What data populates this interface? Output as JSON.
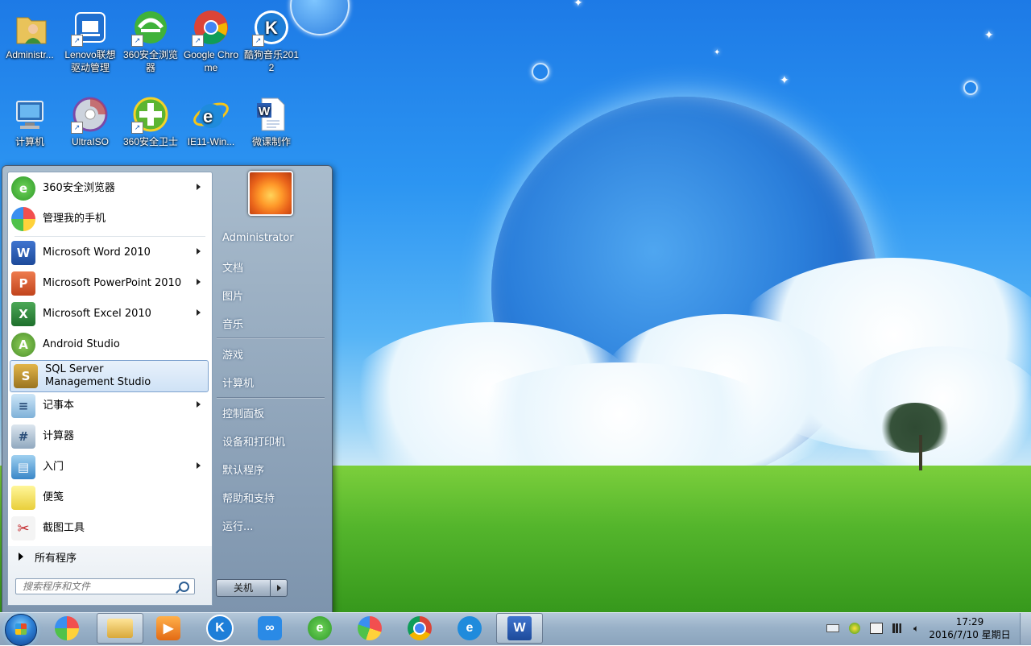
{
  "desktop": {
    "icons": [
      {
        "label": "Administr...",
        "icon": "user-folder-icon"
      },
      {
        "label": "Lenovo联想驱动管理",
        "icon": "lenovo-driver-icon"
      },
      {
        "label": "360安全浏览器",
        "icon": "browser-360-icon"
      },
      {
        "label": "Google Chrome",
        "icon": "chrome-icon"
      },
      {
        "label": "酷狗音乐2012",
        "icon": "kugou-icon"
      },
      {
        "label": "计算机",
        "icon": "computer-icon"
      },
      {
        "label": "UltraISO",
        "icon": "ultraiso-disc-icon"
      },
      {
        "label": "360安全卫士",
        "icon": "guard-360-icon"
      },
      {
        "label": "IE11-Win...",
        "icon": "ie-icon"
      },
      {
        "label": "微课制作",
        "icon": "word-document-icon"
      }
    ]
  },
  "start_menu": {
    "programs": [
      {
        "label": "360安全浏览器",
        "icon": "browser-360-icon",
        "has_submenu": true
      },
      {
        "label": "管理我的手机",
        "icon": "phone-manager-icon",
        "has_submenu": false
      },
      {
        "label": "Microsoft Word 2010",
        "icon": "word-icon",
        "has_submenu": true
      },
      {
        "label": "Microsoft PowerPoint 2010",
        "icon": "powerpoint-icon",
        "has_submenu": true
      },
      {
        "label": "Microsoft Excel 2010",
        "icon": "excel-icon",
        "has_submenu": true
      },
      {
        "label": "Android Studio",
        "icon": "android-studio-icon",
        "has_submenu": false
      },
      {
        "label": "SQL Server Management Studio",
        "icon": "sql-server-icon",
        "has_submenu": false,
        "selected": true
      },
      {
        "label": "记事本",
        "icon": "notepad-icon",
        "has_submenu": true
      },
      {
        "label": "计算器",
        "icon": "calculator-icon",
        "has_submenu": false
      },
      {
        "label": "入门",
        "icon": "getting-started-icon",
        "has_submenu": true
      },
      {
        "label": "便笺",
        "icon": "sticky-notes-icon",
        "has_submenu": false
      },
      {
        "label": "截图工具",
        "icon": "snipping-tool-icon",
        "has_submenu": false
      }
    ],
    "all_programs": "所有程序",
    "search_placeholder": "搜索程序和文件",
    "right_links": [
      "Administrator",
      "文档",
      "图片",
      "音乐",
      "游戏",
      "计算机",
      "控制面板",
      "设备和打印机",
      "默认程序",
      "帮助和支持",
      "运行..."
    ],
    "shutdown_label": "关机"
  },
  "taskbar": {
    "start_icon": "windows-orb-icon",
    "pinned": [
      {
        "icon": "phone-manager-icon"
      },
      {
        "icon": "explorer-folder-icon",
        "active": true
      },
      {
        "icon": "media-player-icon"
      },
      {
        "icon": "kugou-icon"
      },
      {
        "icon": "baidu-cloud-icon"
      },
      {
        "icon": "browser-360-icon"
      },
      {
        "icon": "ball-app-icon"
      },
      {
        "icon": "chrome-icon"
      },
      {
        "icon": "ie-icon"
      },
      {
        "icon": "word-icon",
        "active": true
      }
    ],
    "tray_icons": [
      "keyboard-icon",
      "guard-360-tray-icon",
      "clipboard-icon",
      "network-signal-icon",
      "volume-icon"
    ],
    "clock_time": "17:29",
    "clock_date": "2016/7/10 星期日"
  }
}
